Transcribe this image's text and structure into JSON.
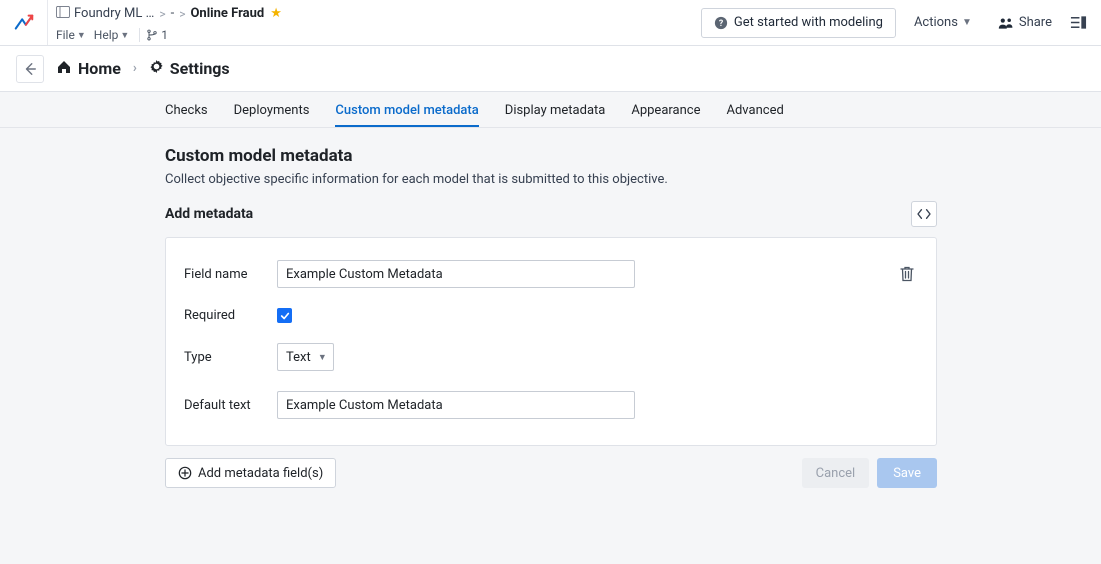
{
  "topbar": {
    "workspace": "Foundry ML …",
    "separator1": ">",
    "dash": "-",
    "separator2": ">",
    "title": "Online Fraud",
    "menus": {
      "file": "File",
      "help": "Help"
    },
    "branch": "1",
    "get_started": "Get started with modeling",
    "actions": "Actions",
    "share": "Share"
  },
  "breadcrumb": {
    "home": "Home",
    "settings": "Settings"
  },
  "tabs": [
    {
      "label": "Checks",
      "active": false
    },
    {
      "label": "Deployments",
      "active": false
    },
    {
      "label": "Custom model metadata",
      "active": true
    },
    {
      "label": "Display metadata",
      "active": false
    },
    {
      "label": "Appearance",
      "active": false
    },
    {
      "label": "Advanced",
      "active": false
    }
  ],
  "section": {
    "title": "Custom model metadata",
    "description": "Collect objective specific information for each model that is submitted to this objective.",
    "add_title": "Add metadata"
  },
  "form": {
    "labels": {
      "field_name": "Field name",
      "required": "Required",
      "type": "Type",
      "default_text": "Default text"
    },
    "values": {
      "field_name": "Example Custom Metadata",
      "required_checked": true,
      "type": "Text",
      "default_text": "Example Custom Metadata"
    }
  },
  "footer": {
    "add": "Add metadata field(s)",
    "cancel": "Cancel",
    "save": "Save"
  }
}
